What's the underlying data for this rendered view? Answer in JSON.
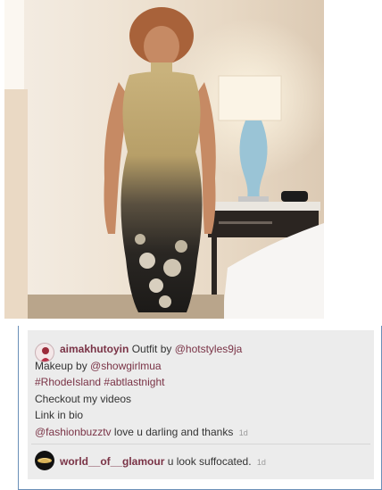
{
  "post": {
    "username": "aimakhutoyin",
    "caption_prefix": "Outfit by",
    "mention_1": "@hotstyles9ja",
    "line_2_prefix": "Makeup by",
    "mention_2": "@showgirlmua",
    "hashtag_1": "#RhodeIsland",
    "hashtag_2": "#abtlastnight",
    "line_4": "Checkout my videos",
    "line_5": "Link in bio",
    "mention_3": "@fashionbuzztv",
    "line_6_rest": "love u darling and thanks",
    "time": "1d"
  },
  "reply": {
    "username": "world__of__glamour",
    "text": "u look suffocated.",
    "time": "1d"
  },
  "colors": {
    "username": "#7a3346",
    "card_border": "#6a8fb8",
    "card_bg": "#ececec"
  }
}
